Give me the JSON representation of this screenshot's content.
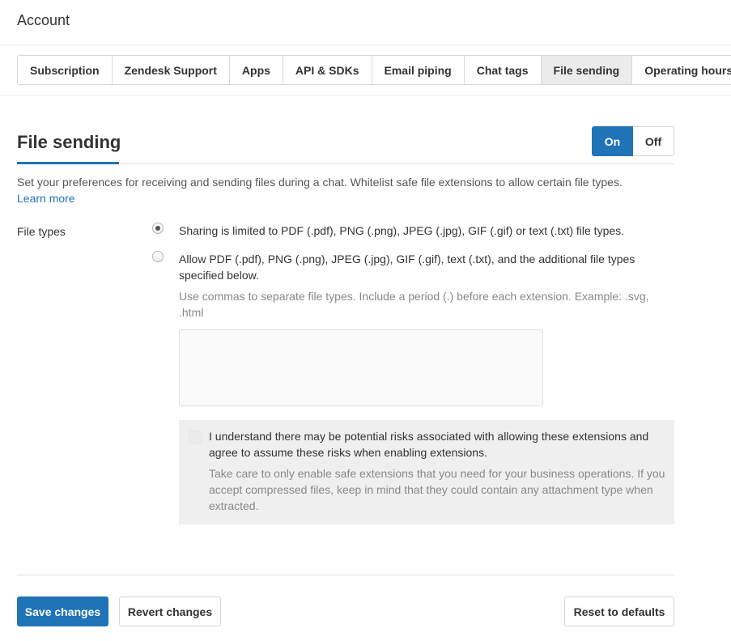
{
  "header": {
    "title": "Account"
  },
  "tabs": [
    {
      "label": "Subscription",
      "active": false
    },
    {
      "label": "Zendesk Support",
      "active": false
    },
    {
      "label": "Apps",
      "active": false
    },
    {
      "label": "API & SDKs",
      "active": false
    },
    {
      "label": "Email piping",
      "active": false
    },
    {
      "label": "Chat tags",
      "active": false
    },
    {
      "label": "File sending",
      "active": true
    },
    {
      "label": "Operating hours",
      "active": false
    }
  ],
  "section": {
    "title": "File sending",
    "toggle": {
      "on_label": "On",
      "off_label": "Off",
      "value": "On"
    },
    "description": "Set your preferences for receiving and sending files during a chat. Whitelist safe file extensions to allow certain file types.",
    "learn_more": "Learn more"
  },
  "file_types": {
    "label": "File types",
    "option_limited": "Sharing is limited to PDF (.pdf), PNG (.png), JPEG (.jpg), GIF (.gif) or text (.txt) file types.",
    "option_additional": "Allow PDF (.pdf), PNG (.png), JPEG (.jpg), GIF (.gif), text (.txt), and the additional file types specified below.",
    "selected": "limited",
    "hint": "Use commas to separate file types. Include a period (.) before each extension. Example: .svg, .html",
    "extensions_value": ""
  },
  "risk": {
    "text": "I understand there may be potential risks associated with allowing these extensions and agree to assume these risks when enabling extensions.",
    "note": "Take care to only enable safe extensions that you need for your business operations. If you accept compressed files, keep in mind that they could contain any attachment type when extracted.",
    "checked": false
  },
  "footer": {
    "save_label": "Save changes",
    "revert_label": "Revert changes",
    "reset_label": "Reset to defaults"
  },
  "colors": {
    "accent": "#1f73b7",
    "active_tab": "#ebebeb",
    "risk_box": "#efefef"
  }
}
